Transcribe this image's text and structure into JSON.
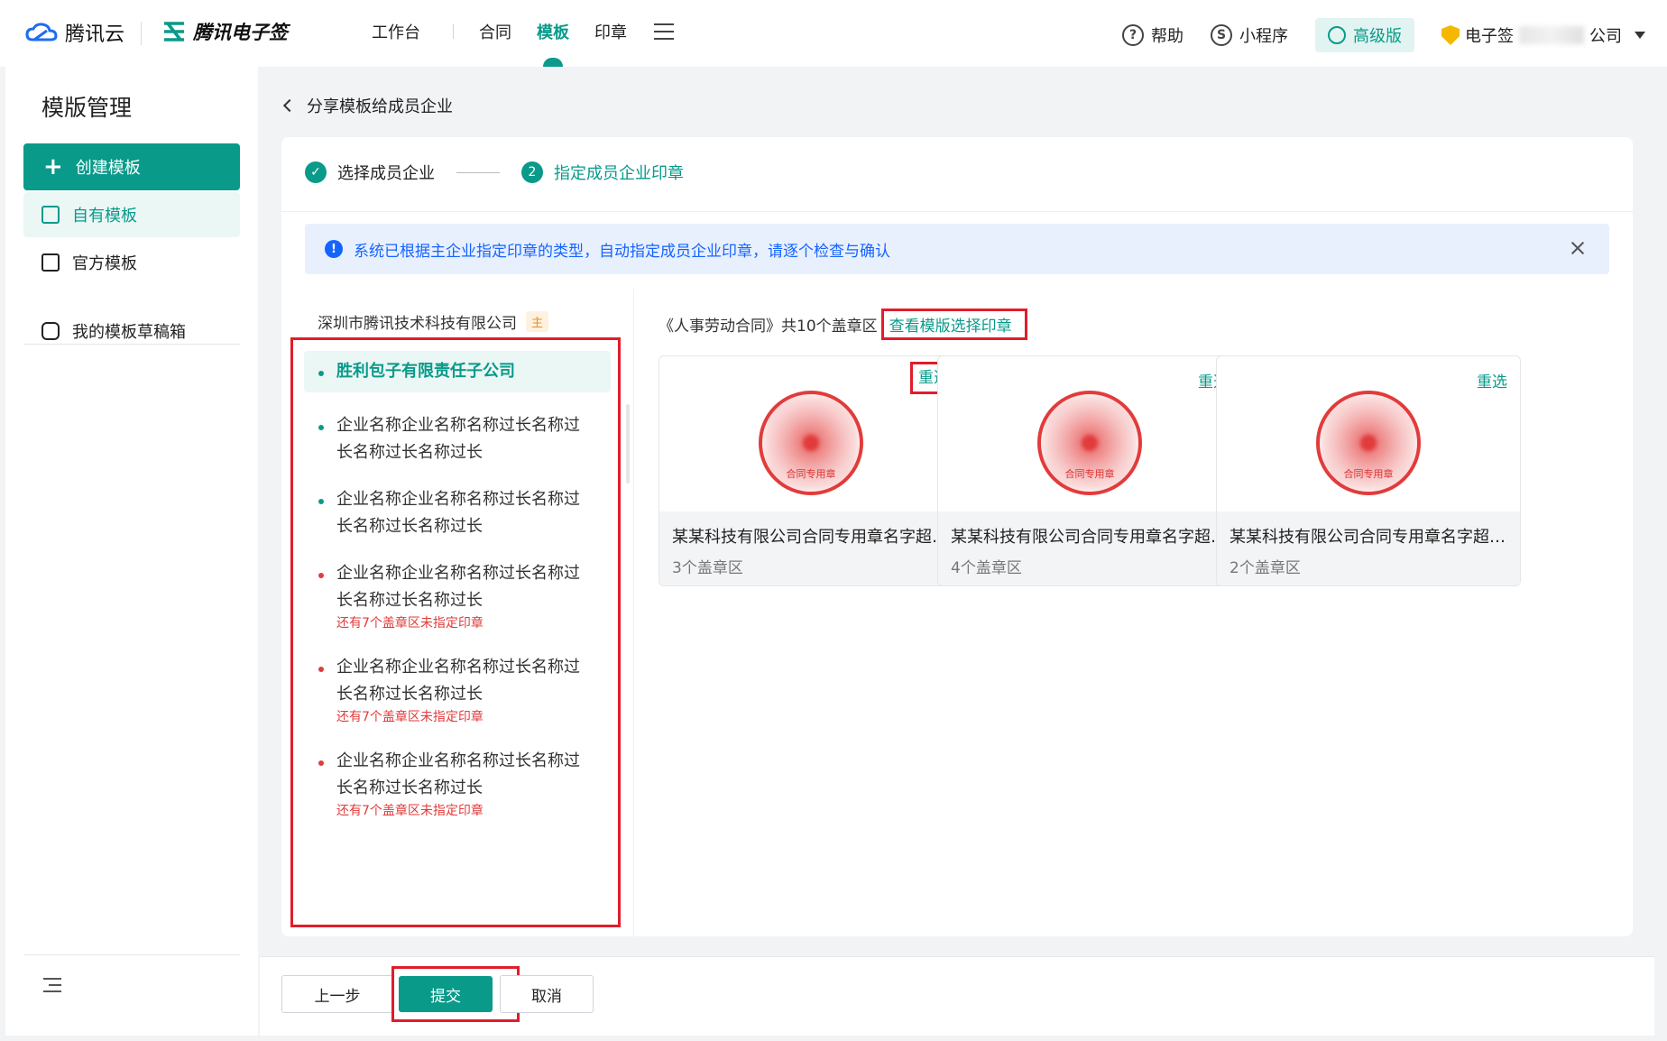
{
  "topbar": {
    "brand_name": "腾讯云",
    "product_name": "腾讯电子签",
    "nav": {
      "workbench": "工作台",
      "contract": "合同",
      "template": "模板",
      "seal": "印章"
    },
    "help": "帮助",
    "miniprogram": "小程序",
    "premium": "高级版",
    "company_prefix": "电子签",
    "company_suffix": "公司"
  },
  "sidebar": {
    "title": "模版管理",
    "create_button": "创建模板",
    "items": [
      {
        "label": "自有模板"
      },
      {
        "label": "官方模板"
      },
      {
        "label": "我的模板草稿箱"
      }
    ]
  },
  "page": {
    "back_title": "分享模板给成员企业",
    "steps": [
      {
        "label": "选择成员企业",
        "status": "done"
      },
      {
        "number": "2",
        "label": "指定成员企业印章",
        "status": "active"
      }
    ],
    "alert": "系统已根据主企业指定印章的类型，自动指定成员企业印章，请逐个检查与确认",
    "main_company": "深圳市腾讯技术科技有限公司",
    "main_tag": "主",
    "members": [
      {
        "name": "胜利包子有限责任子公司",
        "line2": "",
        "hint": ""
      },
      {
        "name": "企业名称企业名称名称过长名称过",
        "line2": "长名称过长名称过长",
        "hint": ""
      },
      {
        "name": "企业名称企业名称名称过长名称过",
        "line2": "长名称过长名称过长",
        "hint": ""
      },
      {
        "name": "企业名称企业名称名称过长名称过",
        "line2": "长名称过长名称过长",
        "hint": "还有7个盖章区未指定印章"
      },
      {
        "name": "企业名称企业名称名称过长名称过",
        "line2": "长名称过长名称过长",
        "hint": "还有7个盖章区未指定印章"
      },
      {
        "name": "企业名称企业名称名称过长名称过",
        "line2": "长名称过长名称过长",
        "hint": "还有7个盖章区未指定印章"
      }
    ],
    "contract_info": "《人事劳动合同》共10个盖章区",
    "view_link": "查看模版选择印章",
    "seals": [
      {
        "reselect": "重选",
        "name": "某某科技有限公司合同专用章名字超长名字超长",
        "count": "3个盖章区",
        "seal_text": "合同专用章"
      },
      {
        "reselect": "重选",
        "name": "某某科技有限公司合同专用章名字超长名字超长",
        "count": "4个盖章区",
        "seal_text": "合同专用章"
      },
      {
        "reselect": "重选",
        "name": "某某科技有限公司合同专用章名字超长名字超长",
        "count": "2个盖章区",
        "seal_text": "合同专用章"
      }
    ]
  },
  "footer": {
    "prev": "上一步",
    "submit": "提交",
    "cancel": "取消"
  },
  "colors": {
    "accent": "#0a9a8a",
    "alert_blue": "#1664ff",
    "warn_red": "#e23b3b",
    "highlight_red": "#e01d2b"
  }
}
